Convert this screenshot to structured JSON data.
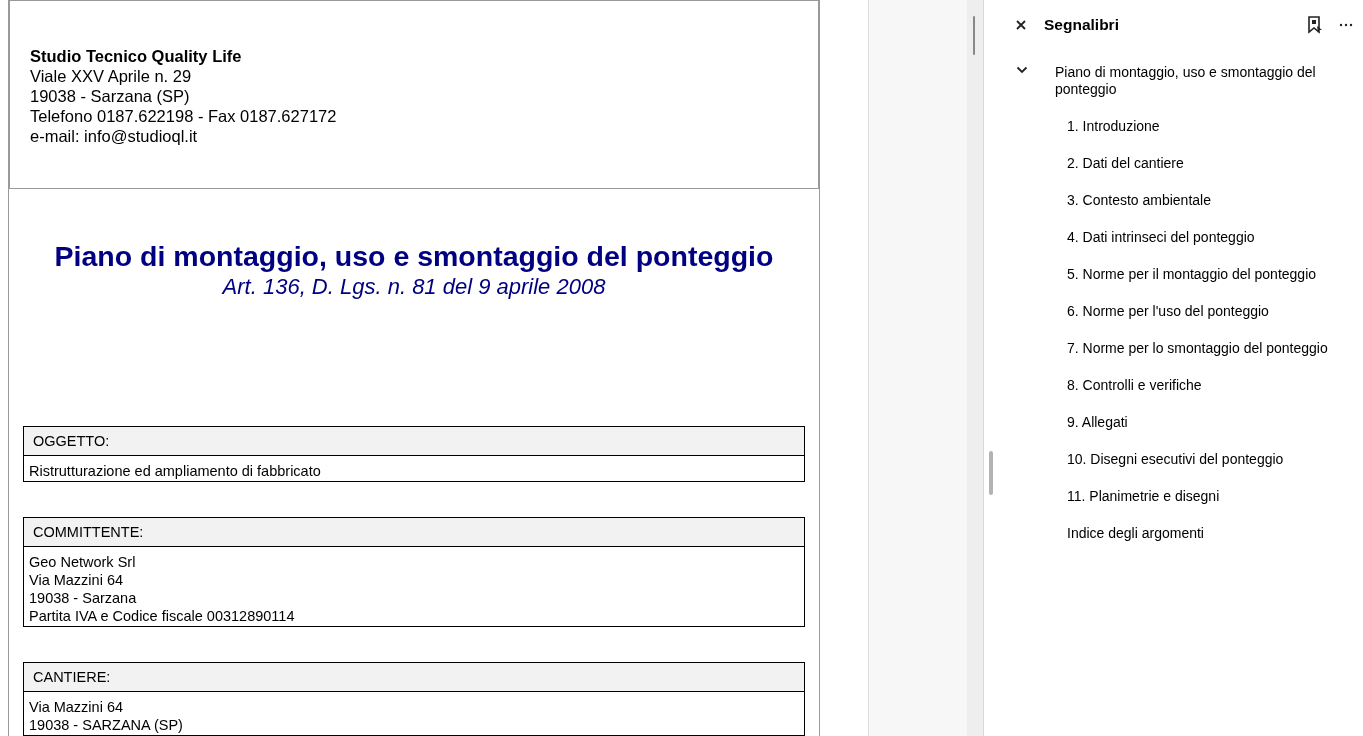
{
  "document": {
    "letterhead": {
      "company": "Studio Tecnico Quality Life",
      "lines": [
        "Viale XXV Aprile n. 29",
        "19038 - Sarzana (SP)",
        "Telefono 0187.622198 - Fax 0187.627172",
        "e-mail: info@studioql.it"
      ]
    },
    "title": "Piano di montaggio, uso e smontaggio del ponteggio",
    "subtitle": "Art. 136, D. Lgs. n. 81 del 9 aprile 2008",
    "sections": [
      {
        "heading": "OGGETTO:",
        "lines": [
          "Ristrutturazione ed ampliamento di fabbricato"
        ]
      },
      {
        "heading": "COMMITTENTE:",
        "lines": [
          "Geo Network Srl",
          "Via Mazzini 64",
          "19038 - Sarzana",
          "Partita IVA e Codice fiscale 00312890114"
        ]
      },
      {
        "heading": "CANTIERE:",
        "lines": [
          "Via Mazzini 64",
          "19038 - SARZANA (SP)"
        ]
      }
    ]
  },
  "bookmarks_panel": {
    "title": "Segnalibri",
    "items": [
      {
        "label": "Piano di montaggio, uso e smontaggio del ponteggio",
        "expanded": true,
        "children": [
          {
            "label": "1. Introduzione"
          },
          {
            "label": "2. Dati del cantiere"
          },
          {
            "label": "3. Contesto ambientale"
          },
          {
            "label": "4. Dati intrinseci del ponteggio"
          },
          {
            "label": "5. Norme per il montaggio del ponteggio"
          },
          {
            "label": "6. Norme per l'uso del ponteggio"
          },
          {
            "label": "7. Norme per lo smontaggio del ponteggio"
          },
          {
            "label": "8. Controlli e verifiche"
          },
          {
            "label": "9. Allegati"
          },
          {
            "label": "10. Disegni esecutivi del ponteggio"
          },
          {
            "label": "11. Planimetrie e disegni"
          },
          {
            "label": "Indice degli argomenti"
          }
        ]
      }
    ]
  }
}
